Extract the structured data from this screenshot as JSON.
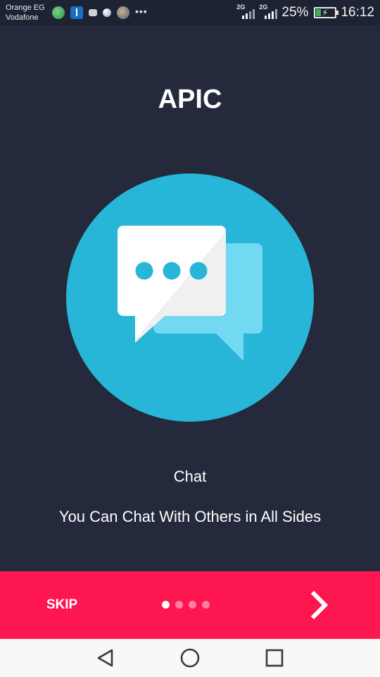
{
  "status_bar": {
    "carrier_1": "Orange EG",
    "carrier_2": "Vodafone",
    "network_1": "2G",
    "network_2": "2G",
    "battery_percent": "25%",
    "battery_level": 0.25,
    "time": "16:12",
    "notification_icons": [
      "globe-icon",
      "usb-icon",
      "message-icon",
      "moon-icon",
      "planet-icon",
      "more-icon"
    ],
    "more_glyph": "•••"
  },
  "app": {
    "title": "APIC"
  },
  "slide": {
    "title": "Chat",
    "description": "You Can Chat With Others in All Sides",
    "illustration": "chat-bubbles-icon"
  },
  "action_bar": {
    "skip_label": "SKIP",
    "page_count": 4,
    "active_page": 1,
    "next_icon": "chevron-right-icon"
  },
  "nav_bar": {
    "icons": [
      "back-icon",
      "home-icon",
      "recents-icon"
    ]
  },
  "colors": {
    "background": "#242a3c",
    "accent": "#fe1651",
    "circle": "#27b6d7",
    "bubble_light": "#73d9f2"
  }
}
